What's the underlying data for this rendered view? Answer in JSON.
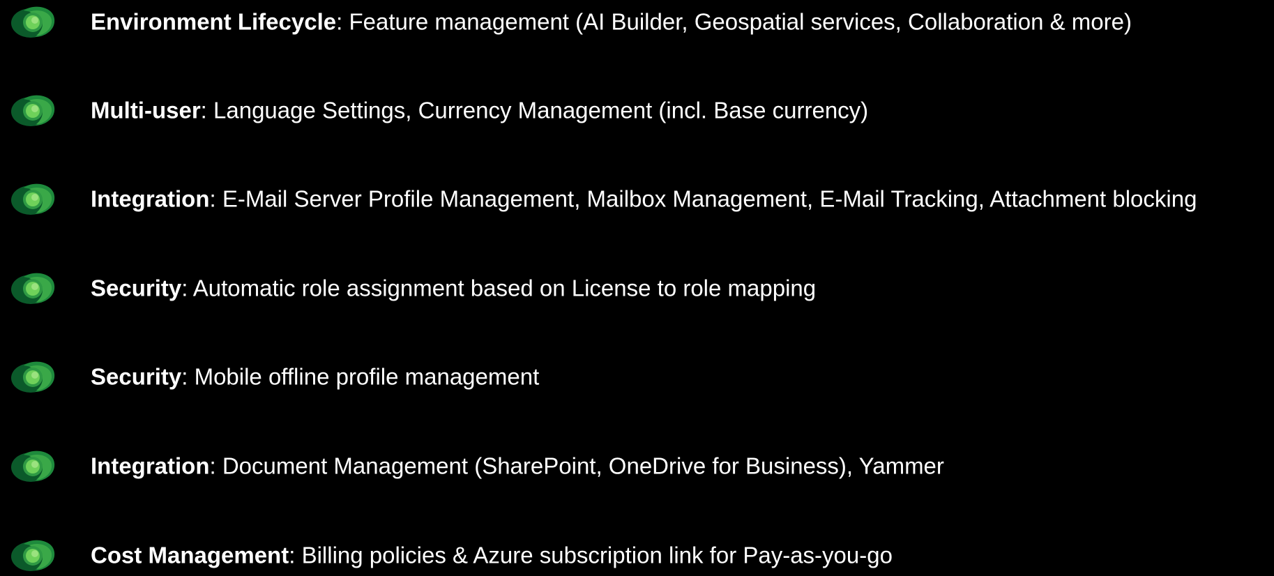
{
  "colors": {
    "background": "#000000",
    "text": "#ffffff",
    "icon_dark": "#0b5a2a",
    "icon_mid": "#1e8a3c",
    "icon_light": "#6fd15a"
  },
  "items": [
    {
      "title": "Environment Lifecycle",
      "separator": ": ",
      "description": "Feature management (AI Builder, Geospatial services, Collaboration & more)",
      "icon": "dataverse-logo-icon"
    },
    {
      "title": "Multi-user",
      "separator": ": ",
      "description": "Language Settings, Currency Management (incl. Base currency)",
      "icon": "dataverse-logo-icon"
    },
    {
      "title": "Integration",
      "separator": ": ",
      "description": "E-Mail Server Profile Management, Mailbox Management, E-Mail Tracking, Attachment blocking",
      "icon": "dataverse-logo-icon"
    },
    {
      "title": "Security",
      "separator": ": ",
      "description": "Automatic role assignment based on License to role mapping",
      "icon": "dataverse-logo-icon"
    },
    {
      "title": "Security",
      "separator": ": ",
      "description": "Mobile offline profile management",
      "icon": "dataverse-logo-icon"
    },
    {
      "title": "Integration",
      "separator": ": ",
      "description": "Document Management (SharePoint, OneDrive for Business), Yammer",
      "icon": "dataverse-logo-icon"
    },
    {
      "title": "Cost Management",
      "separator": ": ",
      "description": "Billing policies & Azure subscription link for Pay-as-you-go",
      "icon": "dataverse-logo-icon"
    }
  ]
}
